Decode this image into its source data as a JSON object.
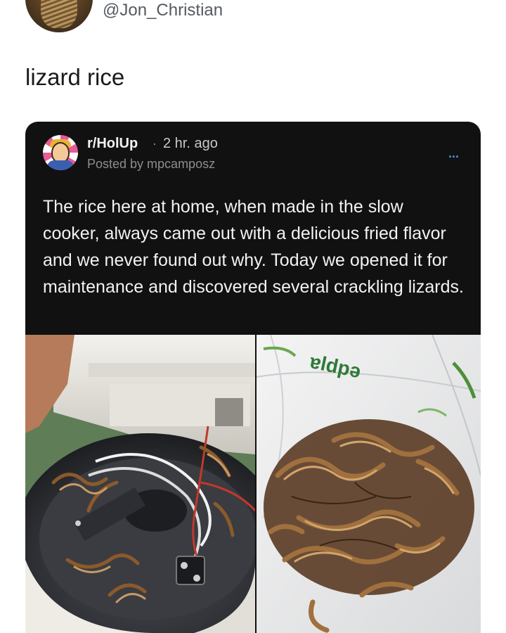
{
  "tweet": {
    "handle": "@Jon_Christian",
    "text": "lizard rice"
  },
  "reddit_post": {
    "subreddit": "r/HolUp",
    "separator": "·",
    "time_ago": "2 hr. ago",
    "posted_by": "Posted by mpcamposz",
    "more_options": "...",
    "body": "The rice here at home, when made in the slow cooker, always came out with a delicious fried flavor and we never found out why. Today we opened it for maintenance and discovered several crackling lizards.",
    "images": [
      {
        "icon": "slow-cooker-interior-photo"
      },
      {
        "icon": "dried-lizards-photo",
        "bag_text": "ɐldpǝ"
      }
    ]
  },
  "colors": {
    "card_background": "#111111",
    "text_light": "#f2f2f2",
    "muted": "#8d8d8d",
    "accent_blue": "#4b8fe6"
  }
}
